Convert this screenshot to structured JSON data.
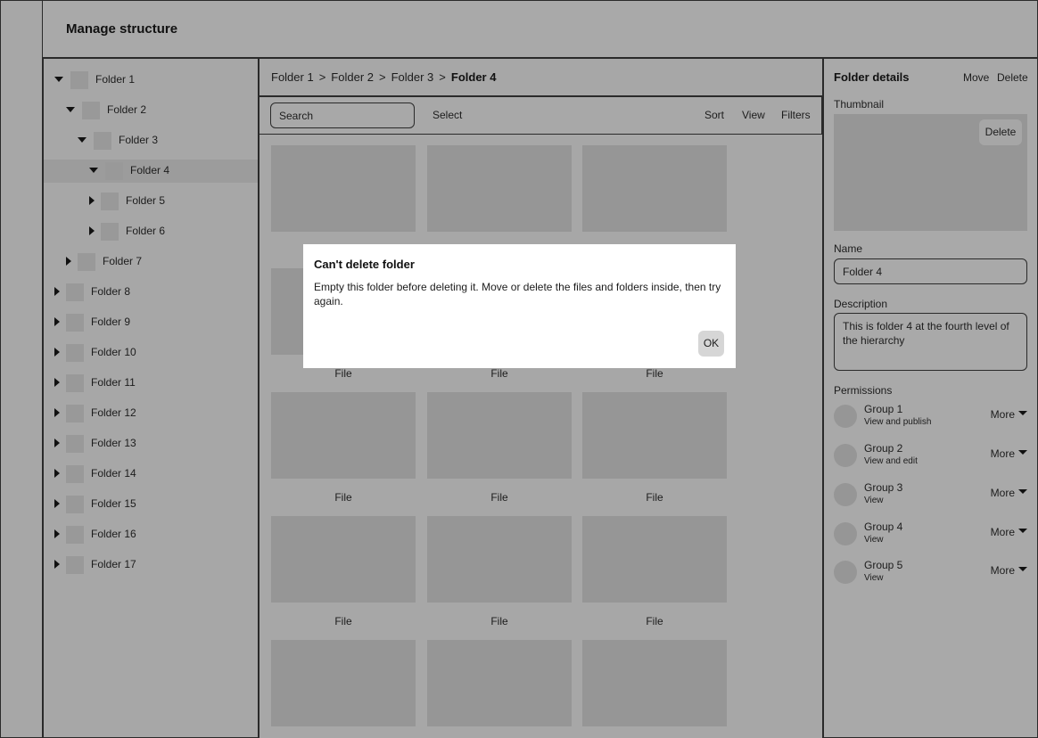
{
  "header": {
    "title": "Manage structure"
  },
  "tree": {
    "items": [
      {
        "label": "Folder 1"
      },
      {
        "label": "Folder 2"
      },
      {
        "label": "Folder 3"
      },
      {
        "label": "Folder 4",
        "selected": true
      },
      {
        "label": "Folder 5"
      },
      {
        "label": "Folder 6"
      },
      {
        "label": "Folder 7"
      },
      {
        "label": "Folder 8"
      },
      {
        "label": "Folder 9"
      },
      {
        "label": "Folder 10"
      },
      {
        "label": "Folder 11"
      },
      {
        "label": "Folder 12"
      },
      {
        "label": "Folder 13"
      },
      {
        "label": "Folder 14"
      },
      {
        "label": "Folder 15"
      },
      {
        "label": "Folder 16"
      },
      {
        "label": "Folder 17"
      }
    ]
  },
  "breadcrumb": {
    "items": [
      "Folder 1",
      "Folder 2",
      "Folder 3",
      "Folder 4"
    ],
    "separator": ">"
  },
  "toolbar": {
    "search_placeholder": "Search",
    "select_label": "Select",
    "sort_label": "Sort",
    "view_label": "View",
    "filters_label": "Filters"
  },
  "grid": {
    "file_label": "File"
  },
  "details": {
    "title": "Folder details",
    "move_label": "Move",
    "delete_label": "Delete",
    "thumbnail_label": "Thumbnail",
    "thumbnail_delete_label": "Delete",
    "name_label": "Name",
    "name_value": "Folder 4",
    "description_label": "Description",
    "description_value": "This is folder 4 at the fourth level of the hierarchy",
    "permissions_label": "Permissions",
    "permissions": [
      {
        "group": "Group 1",
        "role": "View and publish",
        "more": "More"
      },
      {
        "group": "Group 2",
        "role": "View and edit",
        "more": "More"
      },
      {
        "group": "Group 3",
        "role": "View",
        "more": "More"
      },
      {
        "group": "Group 4",
        "role": "View",
        "more": "More"
      },
      {
        "group": "Group 5",
        "role": "View",
        "more": "More"
      }
    ]
  },
  "dialog": {
    "title": "Can't delete folder",
    "message": "Empty this folder before deleting it. Move or delete the files and folders inside, then try again.",
    "ok_label": "OK"
  }
}
